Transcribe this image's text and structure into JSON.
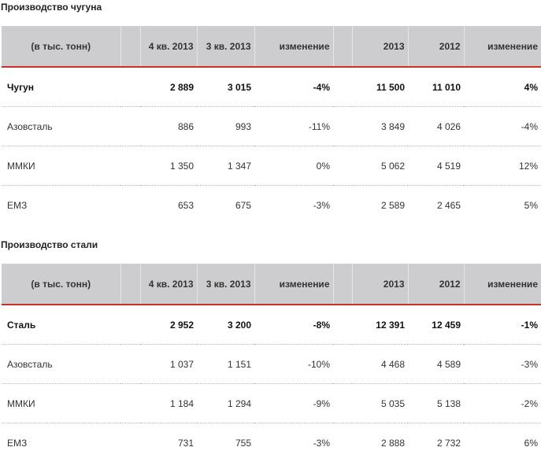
{
  "sections": [
    {
      "title": "Производство чугуна",
      "headers": [
        "(в тыс. тонн)",
        "",
        "4 кв. 2013",
        "3 кв. 2013",
        "изменение",
        "",
        "2013",
        "2012",
        "изменение"
      ],
      "rows": [
        [
          "Чугун",
          "",
          "2 889",
          "3 015",
          "-4%",
          "",
          "11 500",
          "11 010",
          "4%"
        ],
        [
          "Азовсталь",
          "",
          "886",
          "993",
          "-11%",
          "",
          "3 849",
          "4 026",
          "-4%"
        ],
        [
          "ММКИ",
          "",
          "1 350",
          "1 347",
          "0%",
          "",
          "5 062",
          "4 519",
          "12%"
        ],
        [
          "ЕМЗ",
          "",
          "653",
          "675",
          "-3%",
          "",
          "2 589",
          "2 465",
          "5%"
        ]
      ]
    },
    {
      "title": "Производство стали",
      "headers": [
        "(в тыс. тонн)",
        "",
        "4 кв. 2013",
        "3 кв. 2013",
        "изменение",
        "",
        "2013",
        "2012",
        "изменение"
      ],
      "rows": [
        [
          "Сталь",
          "",
          "2 952",
          "3 200",
          "-8%",
          "",
          "12 391",
          "12 459",
          "-1%"
        ],
        [
          "Азовсталь",
          "",
          "1 037",
          "1 151",
          "-10%",
          "",
          "4 468",
          "4 589",
          "-3%"
        ],
        [
          "ММКИ",
          "",
          "1 184",
          "1 294",
          "-9%",
          "",
          "5 035",
          "5 138",
          "-2%"
        ],
        [
          "ЕМЗ",
          "",
          "731",
          "755",
          "-3%",
          "",
          "2 888",
          "2 732",
          "6%"
        ]
      ]
    }
  ],
  "colors": {
    "header_bg": "#cdcdcf",
    "header_rule": "#c8302a",
    "row_divider": "#b5b5b5"
  }
}
